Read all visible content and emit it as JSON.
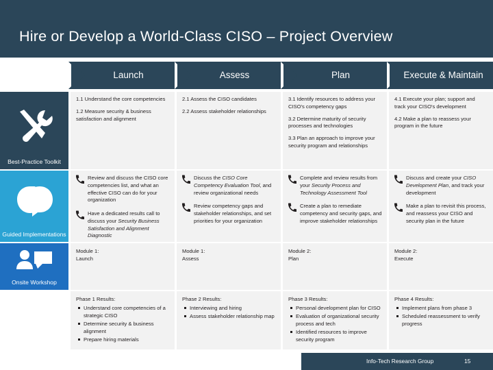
{
  "colors": {
    "navy": "#2b4659",
    "toolkit_bg": "#2b4659",
    "guided_bg": "#2ba3d4",
    "onsite_bg": "#1f6fc0",
    "cell_bg": "#f2f2f2",
    "text": "#231f20",
    "white": "#ffffff"
  },
  "title": "Hire or Develop a World-Class CISO – Project Overview",
  "phases": [
    {
      "label": "Launch"
    },
    {
      "label": "Assess"
    },
    {
      "label": "Plan"
    },
    {
      "label": "Execute & Maintain"
    }
  ],
  "rail": [
    {
      "key": "toolkit",
      "label": "Best-Practice Toolkit",
      "icon": "tools-icon"
    },
    {
      "key": "guided",
      "label": "Guided Implementations",
      "icon": "heads-icon"
    },
    {
      "key": "onsite",
      "label": "Onsite Workshop",
      "icon": "presenter-icon"
    }
  ],
  "steps": [
    [
      "1.1 Understand the core competencies",
      "1.2 Measure security & business satisfaction and alignment"
    ],
    [
      "2.1 Assess the CISO candidates",
      "2.2 Assess stakeholder relationships"
    ],
    [
      "3.1 Identify resources to address your CISO's competency gaps",
      "3.2 Determine maturity of security processes and technologies",
      "3.3 Plan an approach to improve your security program and relationships"
    ],
    [
      "4.1 Execute your plan; support and track your CISO's development",
      "4.2 Make a plan to reassess your program in the future"
    ]
  ],
  "guided": [
    [
      {
        "pre": "Review and discuss the CISO core competencies list, and what an effective CISO can do for your organization",
        "em": "",
        "post": ""
      },
      {
        "pre": "Have a dedicated results call to discuss your ",
        "em": "Security Business Satisfaction and Alignment Diagnostic",
        "post": ""
      }
    ],
    [
      {
        "pre": "Discuss the ",
        "em": "CISO Core Competency Evaluation Tool",
        "post": ", and review organizational needs"
      },
      {
        "pre": "Review competency gaps and stakeholder relationships, and set priorities for your organization",
        "em": "",
        "post": ""
      }
    ],
    [
      {
        "pre": "Complete and review results from your ",
        "em": "Security Process and Technology Assessment Tool",
        "post": ""
      },
      {
        "pre": "Create a plan to remediate competency and security gaps, and improve stakeholder relationships",
        "em": "",
        "post": ""
      }
    ],
    [
      {
        "pre": "Discuss and create your ",
        "em": "CISO Development Plan",
        "post": ", and track your development"
      },
      {
        "pre": "Make a plan to revisit this process, and reassess your CISO and security plan in the future",
        "em": "",
        "post": ""
      }
    ]
  ],
  "modules": [
    {
      "line1": "Module 1:",
      "line2": "Launch"
    },
    {
      "line1": "Module 1:",
      "line2": "Assess"
    },
    {
      "line1": "Module 2:",
      "line2": "Plan"
    },
    {
      "line1": "Module 2:",
      "line2": "Execute"
    }
  ],
  "results": [
    {
      "heading": "Phase 1 Results:",
      "items": [
        "Understand core competencies of a strategic CISO",
        "Determine security & business alignment",
        "Prepare hiring materials"
      ]
    },
    {
      "heading": "Phase 2 Results:",
      "items": [
        "Interviewing and hiring",
        "Assess stakeholder relationship map"
      ]
    },
    {
      "heading": "Phase 3 Results:",
      "items": [
        "Personal development plan for CISO",
        "Evaluation of organizational security process and tech",
        "Identified resources to improve security program"
      ]
    },
    {
      "heading": "Phase 4 Results:",
      "items": [
        "Implement plans from phase 3",
        "Scheduled reassessment to verify progress"
      ]
    }
  ],
  "footer": {
    "name": "Info-Tech Research Group",
    "page": "15"
  }
}
